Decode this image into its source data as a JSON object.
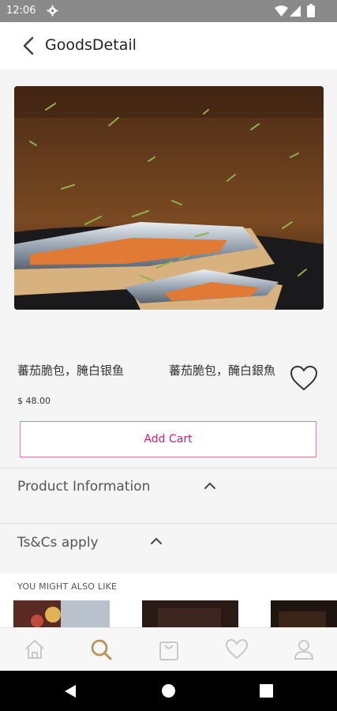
{
  "status_bar": {
    "time": "12:06"
  },
  "app_bar": {
    "title": "GoodsDetail"
  },
  "product": {
    "name_left": "蕃茄脆包，腌白银鱼",
    "name_right": "蕃茄脆包，醃白銀魚",
    "price": "$ 48.00",
    "add_cart_label": "Add Cart"
  },
  "sections": {
    "product_information": "Product Information",
    "terms": "Ts&Cs apply",
    "might_like": "YOU MIGHT ALSO LIKE"
  },
  "colors": {
    "accent_pink": "#d11f7a",
    "active_nav": "#b8935a",
    "inactive_nav": "#c8c8c8"
  },
  "bottom_nav": [
    {
      "icon": "home-icon",
      "active": false
    },
    {
      "icon": "search-icon",
      "active": true
    },
    {
      "icon": "shopping-bag-icon",
      "active": false
    },
    {
      "icon": "heart-icon",
      "active": false
    },
    {
      "icon": "user-icon",
      "active": false
    }
  ]
}
